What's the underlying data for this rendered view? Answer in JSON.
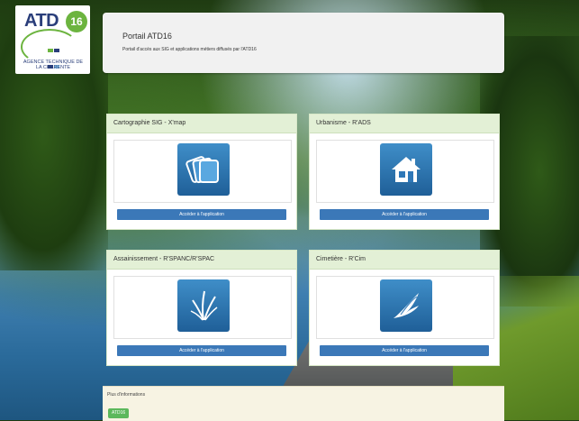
{
  "logo": {
    "name": "ATD",
    "number": "16",
    "department": "AGENCE TECHNIQUE DE LA CHARENTE"
  },
  "header": {
    "title": "Portail ATD16",
    "subtitle": "Portail d'accès aux SIG et applications métiers diffusés par l'ATD16"
  },
  "cards": [
    {
      "title": "Cartographie SIG - X'map",
      "icon": "map-layers-icon",
      "button": "Accéder à l'application"
    },
    {
      "title": "Urbanisme - R'ADS",
      "icon": "house-icon",
      "button": "Accéder à l'application"
    },
    {
      "title": "Assainissement - R'SPANC/R'SPAC",
      "icon": "reeds-icon",
      "button": "Accéder à l'application"
    },
    {
      "title": "Cimetière - R'Cim",
      "icon": "angel-wing-icon",
      "button": "Accéder à l'application"
    }
  ],
  "footer": {
    "title": "Plus d'informations",
    "tag": "ATD16"
  },
  "colors": {
    "card_header": "#e3f0d6",
    "button": "#3b78b8",
    "tile": "#2f78b8",
    "tag": "#5cb85c"
  }
}
